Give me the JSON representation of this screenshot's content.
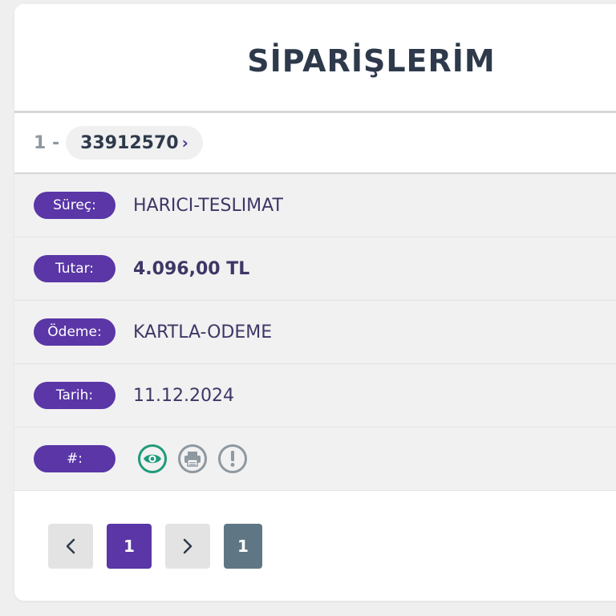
{
  "page": {
    "title": "SİPARİŞLERİM"
  },
  "order": {
    "index": "1 -",
    "number": "33912570",
    "chevron": "›"
  },
  "details": {
    "process": {
      "label": "Süreç:",
      "value": "HARICI-TESLIMAT"
    },
    "amount": {
      "label": "Tutar:",
      "value": "4.096,00 TL"
    },
    "payment": {
      "label": "Ödeme:",
      "value": "KARTLA-ODEME"
    },
    "date": {
      "label": "Tarih:",
      "value": "11.12.2024"
    },
    "actions": {
      "label": "#:"
    }
  },
  "icons": {
    "view": "eye-icon",
    "print": "printer-icon",
    "alert": "exclamation-icon"
  },
  "colors": {
    "accent": "#5a36a6",
    "view_icon": "#1f9a7a",
    "gray_icon": "#8e98a0",
    "title_text": "#2e3a4b"
  },
  "pagination": {
    "prev": "‹",
    "current": "1",
    "next": "›",
    "total": "1"
  }
}
